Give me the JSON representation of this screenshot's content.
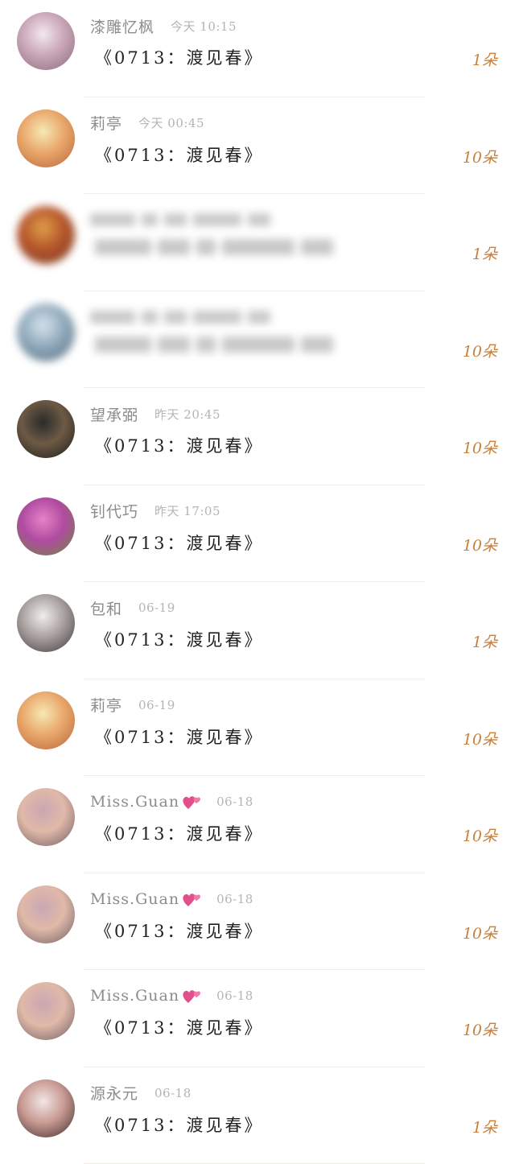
{
  "rows": [
    {
      "name": "漆雕忆枫",
      "time": "今天 10:15",
      "gift": "《0713：渡见春》",
      "amount": "1朵",
      "avatar_colors": [
        "#f3e8ee",
        "#c9a6b8",
        "#8a6b7e"
      ],
      "blurred": false
    },
    {
      "name": "莉亭",
      "time": "今天 00:45",
      "gift": "《0713：渡见春》",
      "amount": "10朵",
      "avatar_colors": [
        "#f6e8b4",
        "#e9a76b",
        "#b8653b"
      ],
      "blurred": false
    },
    {
      "name": "",
      "time": "",
      "gift": "",
      "amount": "1朵",
      "avatar_colors": [
        "#e0a24c",
        "#b5532a",
        "#6e3b25"
      ],
      "blurred": true
    },
    {
      "name": "",
      "time": "",
      "gift": "",
      "amount": "10朵",
      "avatar_colors": [
        "#d9e6ee",
        "#8fa9bb",
        "#4f6677"
      ],
      "blurred": true
    },
    {
      "name": "望承弼",
      "time": "昨天 20:45",
      "gift": "《0713：渡见春》",
      "amount": "10朵",
      "avatar_colors": [
        "#2b2b2b",
        "#6d5a44",
        "#1b1b1b"
      ],
      "blurred": false
    },
    {
      "name": "钊代巧",
      "time": "昨天 17:05",
      "gift": "《0713：渡见春》",
      "amount": "10朵",
      "avatar_colors": [
        "#e383c8",
        "#b04ba0",
        "#6e8a3d"
      ],
      "blurred": false
    },
    {
      "name": "包和",
      "time": "06-19",
      "gift": "《0713：渡见春》",
      "amount": "1朵",
      "avatar_colors": [
        "#f0eeee",
        "#a99f9f",
        "#3f3a3a"
      ],
      "blurred": false
    },
    {
      "name": "莉亭",
      "time": "06-19",
      "gift": "《0713：渡见春》",
      "amount": "10朵",
      "avatar_colors": [
        "#f6e8b4",
        "#e9a76b",
        "#b8653b"
      ],
      "blurred": false
    },
    {
      "name": "Miss.Guan",
      "time": "06-18",
      "gift": "《0713：渡见春》",
      "amount": "10朵",
      "avatar_colors": [
        "#c9a7b3",
        "#e0b9a8",
        "#6f5d64"
      ],
      "blurred": false,
      "heart": true
    },
    {
      "name": "Miss.Guan",
      "time": "06-18",
      "gift": "《0713：渡见春》",
      "amount": "10朵",
      "avatar_colors": [
        "#c9a7b3",
        "#e0b9a8",
        "#6f5d64"
      ],
      "blurred": false,
      "heart": true
    },
    {
      "name": "Miss.Guan",
      "time": "06-18",
      "gift": "《0713：渡见春》",
      "amount": "10朵",
      "avatar_colors": [
        "#c9a7b3",
        "#e0b9a8",
        "#6f5d64"
      ],
      "blurred": false,
      "heart": true
    },
    {
      "name": "源永元",
      "time": "06-18",
      "gift": "《0713：渡见春》",
      "amount": "1朵",
      "avatar_colors": [
        "#f2e6e6",
        "#c89a92",
        "#3b2a2a"
      ],
      "blurred": false
    }
  ],
  "colors": {
    "amount": "#c8803c",
    "name": "#8c8c8c",
    "time": "#b4b4b4",
    "gift": "#222222",
    "heart": "#e0508a"
  },
  "icons": {
    "heart": "two-hearts-icon"
  }
}
